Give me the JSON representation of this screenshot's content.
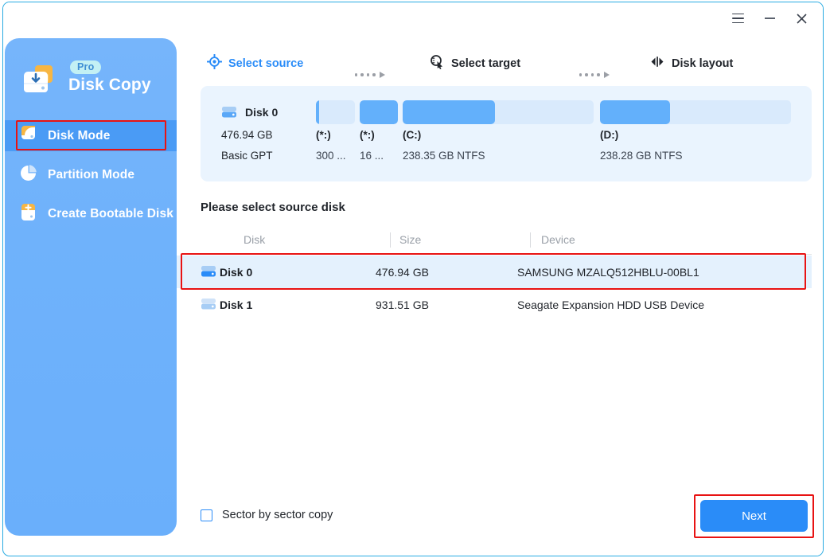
{
  "window": {
    "controls": {
      "menu": "menu-icon",
      "minimize": "minimize-icon",
      "close": "close-icon"
    }
  },
  "sidebar": {
    "brand": {
      "badge": "Pro",
      "title": "Disk Copy"
    },
    "items": [
      {
        "label": "Disk Mode",
        "icon": "disk-mode-icon",
        "active": true
      },
      {
        "label": "Partition Mode",
        "icon": "partition-mode-icon",
        "active": false
      },
      {
        "label": "Create Bootable Disk",
        "icon": "create-bootable-disk-icon",
        "active": false
      }
    ]
  },
  "stepper": {
    "steps": [
      {
        "label": "Select source",
        "icon": "target-crosshair-icon",
        "active": true
      },
      {
        "label": "Select target",
        "icon": "magnifier-cursor-icon",
        "active": false
      },
      {
        "label": "Disk layout",
        "icon": "disk-layout-icon",
        "active": false
      }
    ]
  },
  "layout_panel": {
    "disk_name": "Disk 0",
    "disk_size": "476.94 GB",
    "disk_type": "Basic GPT",
    "partitions": [
      {
        "letter": "(*:)",
        "info": "300 ...",
        "fill_percent": 8
      },
      {
        "letter": "(*:)",
        "info": "16 ...",
        "fill_percent": 100
      },
      {
        "letter": "(C:)",
        "info": "238.35 GB NTFS",
        "fill_percent": 48
      },
      {
        "letter": "(D:)",
        "info": "238.28 GB NTFS",
        "fill_percent": 41
      }
    ]
  },
  "table": {
    "title": "Please select source disk",
    "columns": [
      "Disk",
      "Size",
      "Device"
    ],
    "rows": [
      {
        "disk": "Disk 0",
        "size": "476.94 GB",
        "device": "SAMSUNG MZALQ512HBLU-00BL1",
        "selected": true
      },
      {
        "disk": "Disk 1",
        "size": "931.51 GB",
        "device": "Seagate  Expansion HDD    USB Device",
        "selected": false
      }
    ]
  },
  "footer": {
    "checkbox_label": "Sector by sector copy",
    "checkbox_checked": false,
    "next_label": "Next"
  },
  "colors": {
    "accent": "#2a8cf8",
    "sidebar": "#6fb2fb",
    "highlight": "#e81313",
    "panel_bg": "#eaf4fe",
    "selected_row": "#e4f1fd",
    "pro_badge_bg": "#c3f0f4"
  }
}
